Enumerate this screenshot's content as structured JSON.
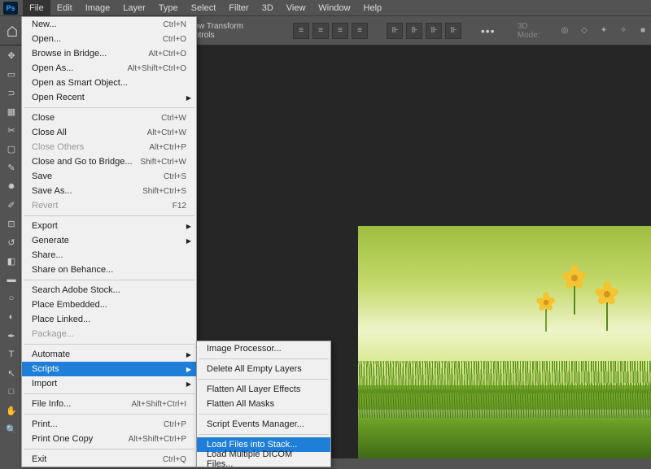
{
  "menubar": {
    "logo": "Ps",
    "items": [
      "File",
      "Edit",
      "Image",
      "Layer",
      "Type",
      "Select",
      "Filter",
      "3D",
      "View",
      "Window",
      "Help"
    ],
    "active": "File"
  },
  "optbar": {
    "transform": "Show Transform Controls",
    "mode_label": "3D Mode:"
  },
  "file_menu": [
    {
      "type": "item",
      "label": "New...",
      "shortcut": "Ctrl+N"
    },
    {
      "type": "item",
      "label": "Open...",
      "shortcut": "Ctrl+O"
    },
    {
      "type": "item",
      "label": "Browse in Bridge...",
      "shortcut": "Alt+Ctrl+O"
    },
    {
      "type": "item",
      "label": "Open As...",
      "shortcut": "Alt+Shift+Ctrl+O"
    },
    {
      "type": "item",
      "label": "Open as Smart Object..."
    },
    {
      "type": "item",
      "label": "Open Recent",
      "arrow": true
    },
    {
      "type": "sep"
    },
    {
      "type": "item",
      "label": "Close",
      "shortcut": "Ctrl+W"
    },
    {
      "type": "item",
      "label": "Close All",
      "shortcut": "Alt+Ctrl+W"
    },
    {
      "type": "item",
      "label": "Close Others",
      "shortcut": "Alt+Ctrl+P",
      "disabled": true
    },
    {
      "type": "item",
      "label": "Close and Go to Bridge...",
      "shortcut": "Shift+Ctrl+W"
    },
    {
      "type": "item",
      "label": "Save",
      "shortcut": "Ctrl+S"
    },
    {
      "type": "item",
      "label": "Save As...",
      "shortcut": "Shift+Ctrl+S"
    },
    {
      "type": "item",
      "label": "Revert",
      "shortcut": "F12",
      "disabled": true
    },
    {
      "type": "sep"
    },
    {
      "type": "item",
      "label": "Export",
      "arrow": true
    },
    {
      "type": "item",
      "label": "Generate",
      "arrow": true
    },
    {
      "type": "item",
      "label": "Share..."
    },
    {
      "type": "item",
      "label": "Share on Behance..."
    },
    {
      "type": "sep"
    },
    {
      "type": "item",
      "label": "Search Adobe Stock..."
    },
    {
      "type": "item",
      "label": "Place Embedded..."
    },
    {
      "type": "item",
      "label": "Place Linked..."
    },
    {
      "type": "item",
      "label": "Package...",
      "disabled": true
    },
    {
      "type": "sep"
    },
    {
      "type": "item",
      "label": "Automate",
      "arrow": true
    },
    {
      "type": "item",
      "label": "Scripts",
      "arrow": true,
      "hl": true
    },
    {
      "type": "item",
      "label": "Import",
      "arrow": true
    },
    {
      "type": "sep"
    },
    {
      "type": "item",
      "label": "File Info...",
      "shortcut": "Alt+Shift+Ctrl+I"
    },
    {
      "type": "sep"
    },
    {
      "type": "item",
      "label": "Print...",
      "shortcut": "Ctrl+P"
    },
    {
      "type": "item",
      "label": "Print One Copy",
      "shortcut": "Alt+Shift+Ctrl+P"
    },
    {
      "type": "sep"
    },
    {
      "type": "item",
      "label": "Exit",
      "shortcut": "Ctrl+Q"
    }
  ],
  "scripts_submenu": [
    {
      "type": "item",
      "label": "Image Processor..."
    },
    {
      "type": "sep"
    },
    {
      "type": "item",
      "label": "Delete All Empty Layers"
    },
    {
      "type": "sep"
    },
    {
      "type": "item",
      "label": "Flatten All Layer Effects"
    },
    {
      "type": "item",
      "label": "Flatten All Masks"
    },
    {
      "type": "sep"
    },
    {
      "type": "item",
      "label": "Script Events Manager..."
    },
    {
      "type": "sep"
    },
    {
      "type": "item",
      "label": "Load Files into Stack...",
      "hl": true
    },
    {
      "type": "item",
      "label": "Load Multiple DICOM Files..."
    }
  ],
  "tools": [
    "move",
    "marquee",
    "lasso",
    "object-select",
    "crop",
    "frame",
    "eyedropper",
    "spot-heal",
    "brush",
    "stamp",
    "history-brush",
    "eraser",
    "gradient",
    "blur",
    "dodge",
    "pen",
    "type",
    "path-select",
    "rectangle",
    "hand",
    "zoom"
  ]
}
